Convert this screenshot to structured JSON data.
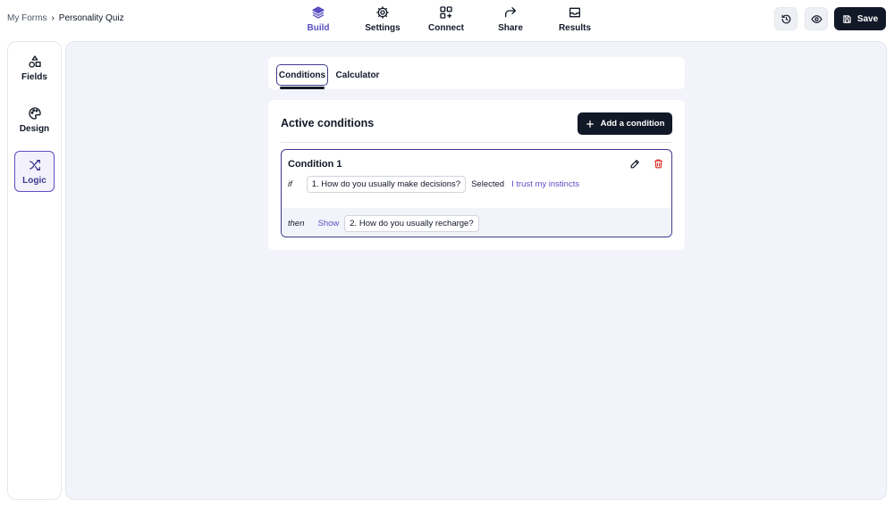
{
  "breadcrumb": {
    "parent": "My Forms",
    "separator": "›",
    "current": "Personality Quiz"
  },
  "topnav": [
    {
      "label": "Build",
      "icon": "layers-icon",
      "active": true
    },
    {
      "label": "Settings",
      "icon": "gear-icon",
      "active": false
    },
    {
      "label": "Connect",
      "icon": "connect-icon",
      "active": false
    },
    {
      "label": "Share",
      "icon": "share-icon",
      "active": false
    },
    {
      "label": "Results",
      "icon": "inbox-icon",
      "active": false
    }
  ],
  "header_actions": {
    "history_icon": "history-icon",
    "preview_icon": "eye-icon",
    "save_label": "Save"
  },
  "sidebar": [
    {
      "label": "Fields",
      "icon": "shapes-icon",
      "active": false
    },
    {
      "label": "Design",
      "icon": "palette-icon",
      "active": false
    },
    {
      "label": "Logic",
      "icon": "shuffle-icon",
      "active": true
    }
  ],
  "tabs": [
    {
      "label": "Conditions",
      "active": true
    },
    {
      "label": "Calculator",
      "active": false
    }
  ],
  "panel": {
    "title": "Active conditions",
    "add_label": "Add a condition",
    "conditions": [
      {
        "title": "Condition 1",
        "if_keyword": "if",
        "question": "1. How do you usually make decisions?",
        "operator": "Selected",
        "value": "I trust my instincts",
        "then_keyword": "then",
        "action": "Show",
        "target": "2. How do you usually recharge?"
      }
    ]
  },
  "colors": {
    "accent": "#5b4fc4",
    "dark": "#111827",
    "canvas": "#f3f3fb",
    "danger": "#dc2626"
  }
}
